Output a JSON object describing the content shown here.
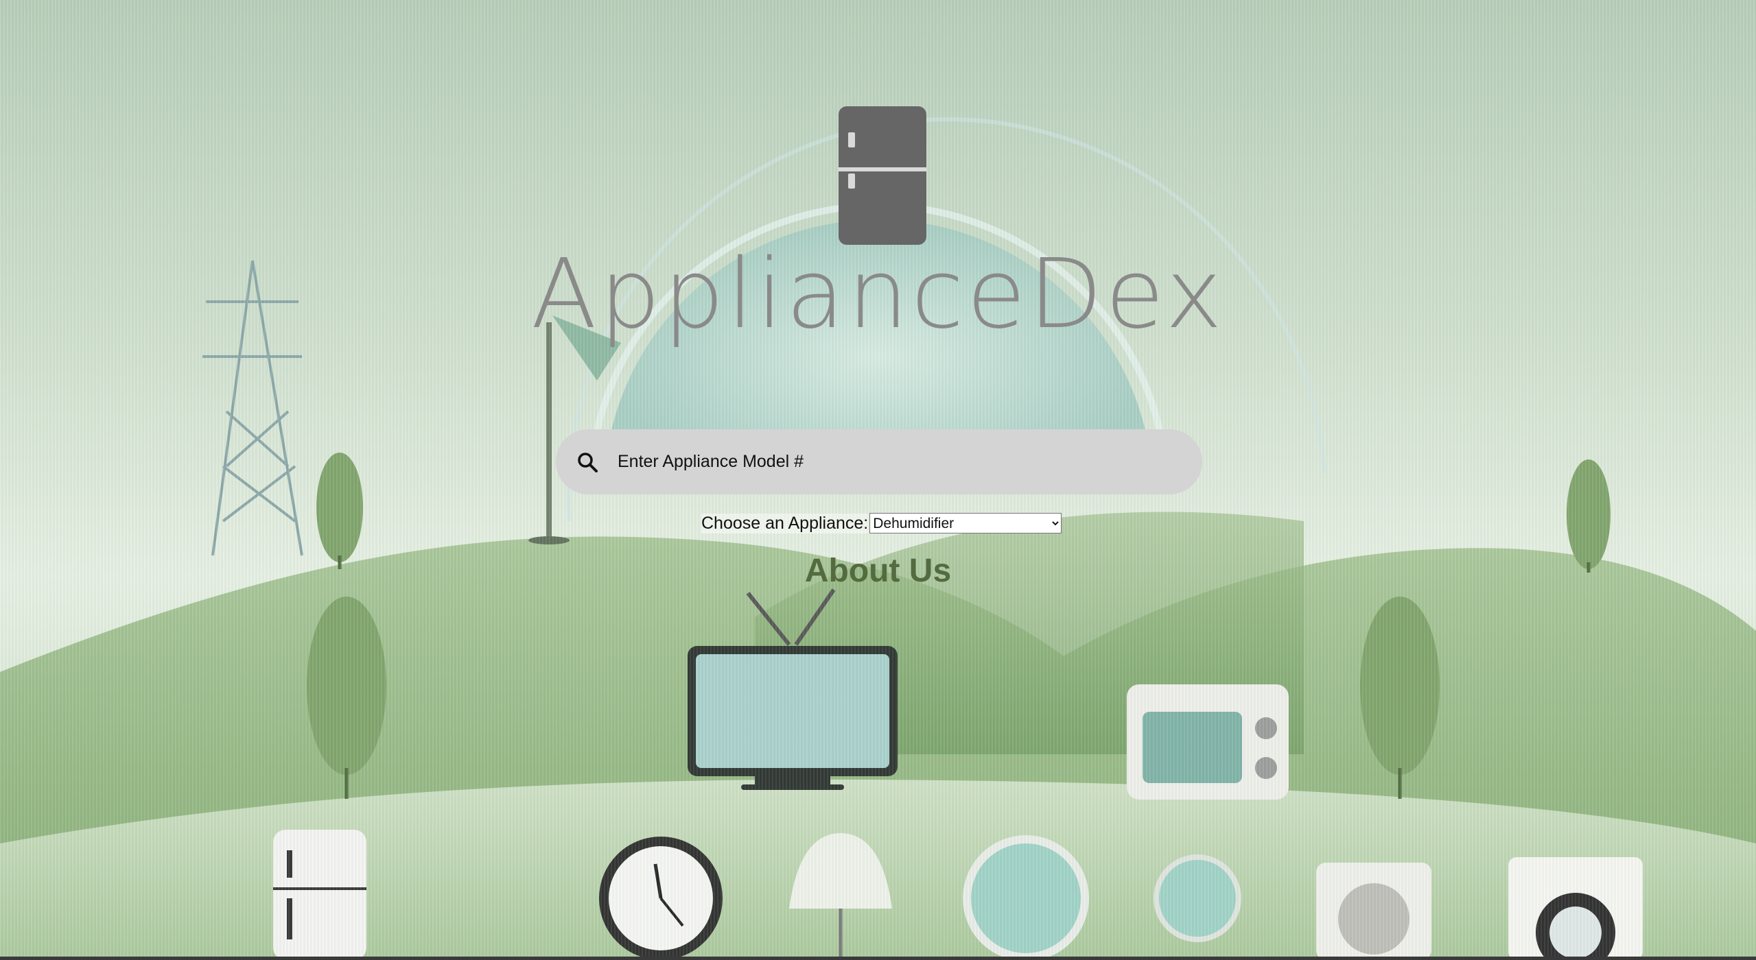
{
  "brand": {
    "name": "ApplianceDex"
  },
  "search": {
    "placeholder": "Enter Appliance Model #"
  },
  "chooser": {
    "label": "Choose an Appliance:",
    "selected": "Dehumidifier"
  },
  "about": {
    "label": "About Us"
  },
  "colors": {
    "search_bg": "#d4d4d4",
    "brand_text": "#8a8a8a",
    "about_text": "#546a3f",
    "logo": "#666666"
  },
  "icons": {
    "logo": "refrigerator-icon",
    "search": "search-icon"
  }
}
